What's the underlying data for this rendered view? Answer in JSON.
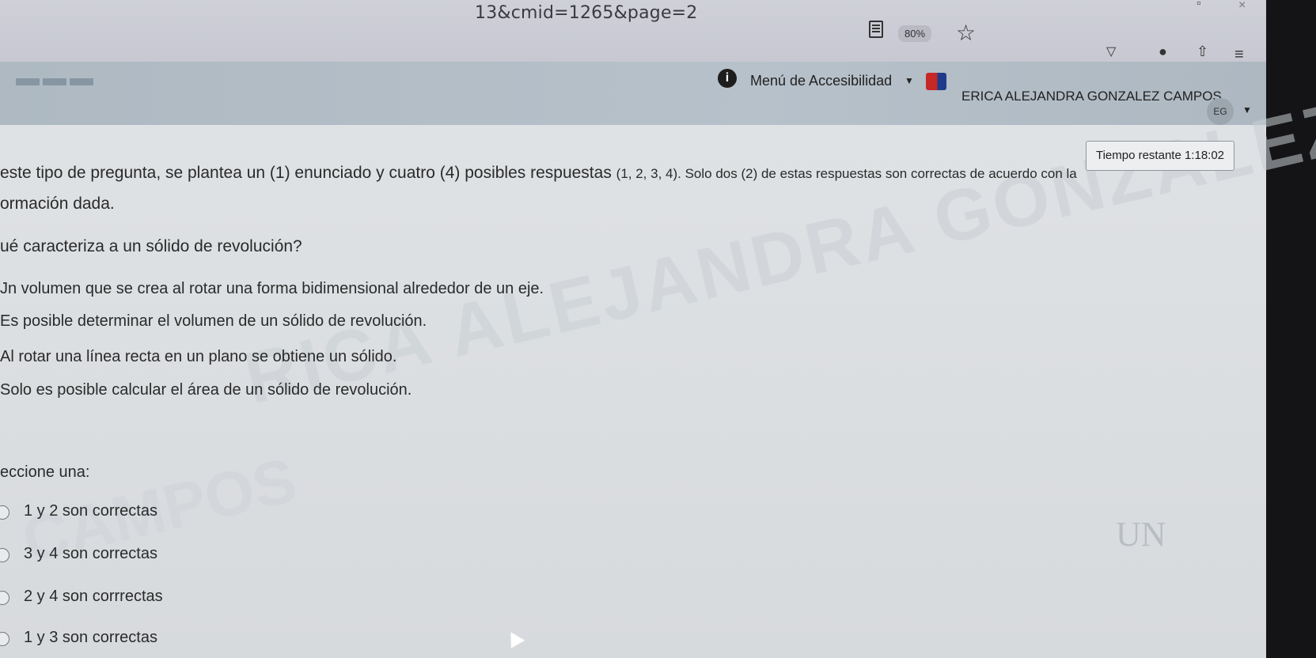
{
  "browser": {
    "url_fragment": "13&cmid=1265&page=2",
    "zoom": "80%",
    "icons": [
      "reader-view-icon",
      "star-icon",
      "pocket-icon",
      "account-icon",
      "share-icon",
      "menu-icon"
    ]
  },
  "header": {
    "accessibility_label": "Menú de Accesibilidad",
    "user_name": "ERICA ALEJANDRA GONZALEZ CAMPOS",
    "avatar_initials": "EG"
  },
  "timer": {
    "label": "Tiempo restante 1:18:02"
  },
  "instructions": {
    "line1_main": "este tipo de pregunta, se plantea un (1) enunciado y cuatro (4) posibles respuestas ",
    "line1_tail": "(1, 2, 3, 4). Solo dos (2) de estas respuestas son correctas de acuerdo con la",
    "line2": "ormación dada."
  },
  "question": "ué caracteriza a un sólido de revolución?",
  "statements": [
    "Jn volumen que se crea al rotar una forma bidimensional alrededor de un eje.",
    "Es posible determinar el volumen de un sólido de revolución.",
    "Al rotar una línea recta en un plano se obtiene un sólido.",
    "Solo es posible calcular el área de un sólido de revolución."
  ],
  "select_label": "eccione una:",
  "options": [
    "1 y 2 son correctas",
    "3 y 4 son correctas",
    "2 y 4 son corrrectas",
    "1 y 3 son correctas"
  ],
  "watermark": {
    "line1": "RICA ALEJANDRA GONZALEZ",
    "line2": "CAMPOS"
  },
  "logo_fragment": "UN"
}
